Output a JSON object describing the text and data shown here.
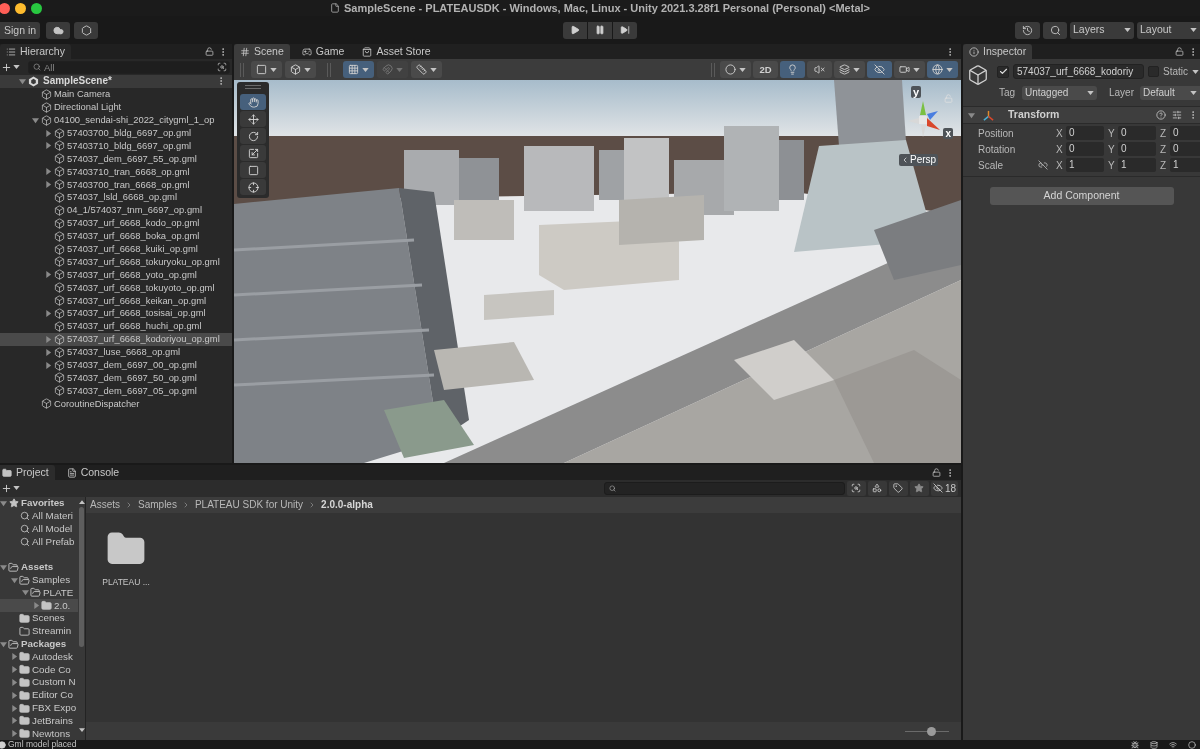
{
  "window": {
    "title": "SampleScene - PLATEAUSDK - Windows, Mac, Linux - Unity 2021.3.28f1 Personal (Personal) <Metal>"
  },
  "toolbar": {
    "sign_in": "Sign in",
    "layers": "Layers",
    "layout": "Layout"
  },
  "hierarchy": {
    "tab": "Hierarchy",
    "search": {
      "placeholder": "All"
    },
    "scene": {
      "name": "SampleScene*",
      "expanded": true,
      "children": [
        {
          "name": "Main Camera",
          "selected": false
        },
        {
          "name": "Directional Light",
          "selected": false
        },
        {
          "name": "04100_sendai-shi_2022_citygml_1_op",
          "expanded": true,
          "selected": false,
          "children": [
            {
              "name": "57403700_bldg_6697_op.gml",
              "expanded": false,
              "selected": false
            },
            {
              "name": "57403710_bldg_6697_op.gml",
              "expanded": false,
              "selected": false
            },
            {
              "name": "574037_dem_6697_55_op.gml",
              "selected": false
            },
            {
              "name": "57403710_tran_6668_op.gml",
              "expanded": false,
              "selected": false
            },
            {
              "name": "57403700_tran_6668_op.gml",
              "expanded": false,
              "selected": false
            },
            {
              "name": "574037_lsld_6668_op.gml",
              "selected": false
            },
            {
              "name": "04_1/574037_tnm_6697_op.gml",
              "selected": false
            },
            {
              "name": "574037_urf_6668_kodo_op.gml",
              "selected": false
            },
            {
              "name": "574037_urf_6668_boka_op.gml",
              "selected": false
            },
            {
              "name": "574037_urf_6668_kuiki_op.gml",
              "selected": false
            },
            {
              "name": "574037_urf_6668_tokuryoku_op.gml",
              "selected": false
            },
            {
              "name": "574037_urf_6668_yoto_op.gml",
              "expanded": false,
              "selected": false
            },
            {
              "name": "574037_urf_6668_tokuyoto_op.gml",
              "selected": false
            },
            {
              "name": "574037_urf_6668_keikan_op.gml",
              "selected": false
            },
            {
              "name": "574037_urf_6668_tosisai_op.gml",
              "expanded": false,
              "selected": false
            },
            {
              "name": "574037_urf_6668_huchi_op.gml",
              "selected": false
            },
            {
              "name": "574037_urf_6668_kodoriyou_op.gml",
              "expanded": false,
              "selected": true
            },
            {
              "name": "574037_luse_6668_op.gml",
              "expanded": false,
              "selected": false
            },
            {
              "name": "574037_dem_6697_00_op.gml",
              "expanded": false,
              "selected": false
            },
            {
              "name": "574037_dem_6697_50_op.gml",
              "selected": false
            },
            {
              "name": "574037_dem_6697_05_op.gml",
              "selected": false
            }
          ]
        },
        {
          "name": "CoroutineDispatcher",
          "selected": false
        }
      ]
    }
  },
  "scene_view": {
    "tabs": [
      {
        "label": "Scene",
        "selected": true
      },
      {
        "label": "Game",
        "selected": false
      },
      {
        "label": "Asset Store",
        "selected": false
      }
    ],
    "toolbar_left": [
      {
        "dropdown": true,
        "selected": false,
        "disabled": false
      },
      {
        "dropdown": true,
        "selected": false,
        "disabled": false
      },
      {
        "dropdown": true,
        "selected": true,
        "disabled": false
      },
      {
        "dropdown": true,
        "selected": false,
        "disabled": true
      },
      {
        "dropdown": true,
        "selected": false,
        "disabled": false
      }
    ],
    "toolbar_right": [
      {
        "dropdown": true,
        "selected": false
      },
      {
        "label": "2D",
        "dropdown": false,
        "selected": false
      },
      {
        "dropdown": false,
        "selected": true
      },
      {
        "dropdown": false,
        "selected": false
      },
      {
        "dropdown": true,
        "selected": false
      },
      {
        "dropdown": false,
        "selected": true
      },
      {
        "dropdown": true,
        "selected": false
      },
      {
        "dropdown": true,
        "selected": true
      }
    ],
    "tools": [
      {
        "selected": true
      },
      {
        "selected": false
      },
      {
        "selected": false
      },
      {
        "selected": false
      },
      {
        "selected": false
      },
      {
        "selected": false
      }
    ],
    "gizmo": {
      "y_axis": "y",
      "x_axis": "x",
      "projection": "Persp"
    }
  },
  "inspector": {
    "tab": "Inspector",
    "object": {
      "active": true,
      "name": "574037_urf_6668_kodoriy",
      "static": false,
      "static_label": "Static",
      "tag_label": "Tag",
      "tag": "Untagged",
      "layer_label": "Layer",
      "layer": "Default"
    },
    "transform": {
      "title": "Transform",
      "expanded": true,
      "rows": [
        {
          "label": "Position",
          "fields": [
            {
              "axis": "X",
              "value": "0"
            },
            {
              "axis": "Y",
              "value": "0"
            },
            {
              "axis": "Z",
              "value": "0"
            }
          ]
        },
        {
          "label": "Rotation",
          "fields": [
            {
              "axis": "X",
              "value": "0"
            },
            {
              "axis": "Y",
              "value": "0"
            },
            {
              "axis": "Z",
              "value": "0"
            }
          ]
        },
        {
          "label": "Scale",
          "constrain_proportions": false,
          "fields": [
            {
              "axis": "X",
              "value": "1"
            },
            {
              "axis": "Y",
              "value": "1"
            },
            {
              "axis": "Z",
              "value": "1"
            }
          ]
        }
      ]
    },
    "add_component": "Add Component"
  },
  "project": {
    "tabs": [
      {
        "label": "Project",
        "selected": true
      },
      {
        "label": "Console",
        "selected": false
      }
    ],
    "hidden_packages": "18",
    "tree": [
      {
        "label": "Favorites",
        "kind": "favorites",
        "expanded": true,
        "selected": false,
        "children": [
          {
            "label": "All Materi",
            "kind": "search",
            "selected": false
          },
          {
            "label": "All Model",
            "kind": "search",
            "selected": false
          },
          {
            "label": "All Prefab",
            "kind": "search",
            "selected": false
          }
        ]
      },
      {
        "label": "Assets",
        "kind": "folder",
        "expanded": true,
        "selected": false,
        "children": [
          {
            "label": "Samples",
            "kind": "folder",
            "expanded": true,
            "selected": false,
            "children": [
              {
                "label": "PLATE",
                "kind": "folder",
                "expanded": true,
                "selected": false,
                "children": [
                  {
                    "label": "2.0.",
                    "kind": "folder",
                    "expanded": false,
                    "selected": true
                  }
                ]
              }
            ]
          },
          {
            "label": "Scenes",
            "kind": "folder",
            "selected": false
          },
          {
            "label": "Streamin",
            "kind": "empty_folder",
            "selected": false
          }
        ]
      },
      {
        "label": "Packages",
        "kind": "folder",
        "expanded": true,
        "selected": false,
        "children": [
          {
            "label": "Autodesk",
            "kind": "folder",
            "expanded": false,
            "selected": false
          },
          {
            "label": "Code Co",
            "kind": "folder",
            "expanded": false,
            "selected": false
          },
          {
            "label": "Custom N",
            "kind": "folder",
            "expanded": false,
            "selected": false
          },
          {
            "label": "Editor Co",
            "kind": "folder",
            "expanded": false,
            "selected": false
          },
          {
            "label": "FBX Expo",
            "kind": "folder",
            "expanded": false,
            "selected": false
          },
          {
            "label": "JetBrains",
            "kind": "folder",
            "expanded": false,
            "selected": false
          },
          {
            "label": "Newtons",
            "kind": "folder",
            "expanded": false,
            "selected": false
          }
        ]
      }
    ],
    "breadcrumb": [
      "Assets",
      "Samples",
      "PLATEAU SDK for Unity",
      "2.0.0-alpha"
    ],
    "items": [
      {
        "label": "PLATEAU ..."
      }
    ],
    "zoom_slider": {
      "level": 0.6
    }
  },
  "status_bar": {
    "message": "Gml model placed"
  }
}
